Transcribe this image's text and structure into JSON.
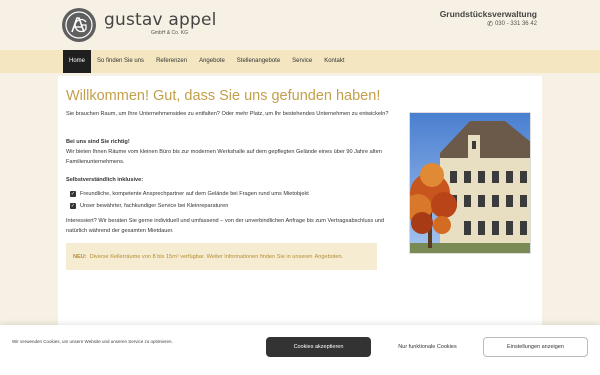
{
  "header": {
    "logo_name": "gustav appel",
    "logo_sub": "GmbH & Co. KG",
    "logo_monogram": "GA",
    "company_type": "Grundstücksverwaltung",
    "phone": "030 - 331 36 42",
    "phone_icon": "phone-icon"
  },
  "nav": {
    "items": [
      {
        "label": "Home"
      },
      {
        "label": "So finden Sie uns"
      },
      {
        "label": "Referenzen"
      },
      {
        "label": "Angebote"
      },
      {
        "label": "Stellenangebote"
      },
      {
        "label": "Service"
      },
      {
        "label": "Kontakt"
      }
    ]
  },
  "main": {
    "title": "Willkommen! Gut, dass Sie uns gefunden haben!",
    "intro": "Sie brauchen Raum, um Ihre Unternehmensidee zu entfalten? Oder mehr Platz, um Ihr bestehendes Unternehmen zu entwickeln?",
    "right_heading": "Bei uns sind Sie richtig!",
    "right_text": "Wir bieten Ihnen Räume vom kleinen Büro bis zur modernen Werkshalle auf dem gepflegten Gelände eines über 90 Jahre alten Familienunternehmens.",
    "included_heading": "Selbstverständlich inklusive:",
    "checklist": [
      "Freundliche, kompetente Ansprechpartner auf dem Gelände bei Fragen rund ums Mietobjekt",
      "Unser bewährter, fachkundiger Service bei Kleinreparaturen"
    ],
    "outro": "Interessiert? Wir beraten Sie gerne individuell und umfassend – von der unverbindlichen Anfrage bis zum Vertragsabschluss und natürlich während der gesamten Mietdauer.",
    "notice": {
      "label": "NEU:",
      "text": "Diverse Kellerräume von 8 bis 15m² verfügbar. Weiter Informationen finden Sie in unseren",
      "link": "Angeboten."
    }
  },
  "cookie": {
    "text": "Wir verwenden Cookies, um unsere Website und unseren Service zu optimieren.",
    "accept": "Cookies akzeptieren",
    "functional": "Nur funktionale Cookies",
    "settings": "Einstellungen anzeigen"
  },
  "colors": {
    "accent": "#c2a04a",
    "nav_bg": "#f3e6c0",
    "page_bg": "#f6f1e4",
    "nav_active": "#1f1f1f"
  }
}
